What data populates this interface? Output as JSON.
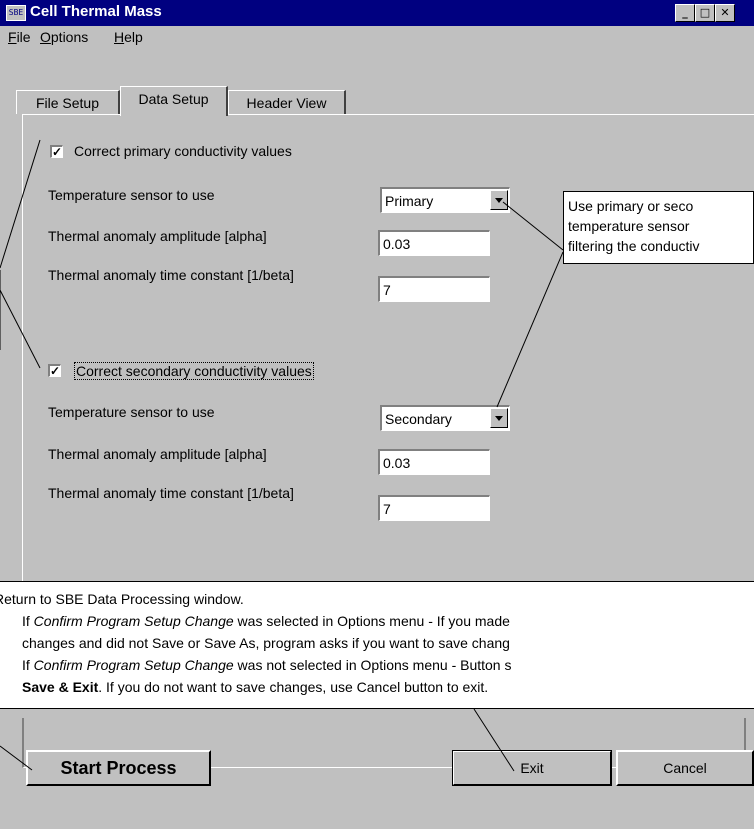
{
  "window": {
    "title": "Cell Thermal Mass",
    "icon": "sbe-app-icon"
  },
  "menu": [
    {
      "label": "File",
      "key": "F",
      "rest": "ile"
    },
    {
      "label": "Options",
      "key": "O",
      "rest": "ptions"
    },
    {
      "label": "Help",
      "key": "H",
      "rest": "elp"
    }
  ],
  "tabs": [
    "File Setup",
    "Data Setup",
    "Header View"
  ],
  "primary": {
    "checkbox_label": "Correct primary conductivity values",
    "checked": true,
    "sensor_label": "Temperature sensor to use",
    "sensor_value": "Primary",
    "alpha_label": "Thermal anomaly amplitude [alpha]",
    "alpha_value": "0.03",
    "beta_label": "Thermal anomaly time constant [1/beta]",
    "beta_value": "7"
  },
  "secondary": {
    "checkbox_label": "Correct secondary conductivity values",
    "checked": true,
    "sensor_label": "Temperature sensor to use",
    "sensor_value": "Secondary",
    "alpha_label": "Thermal anomaly amplitude [alpha]",
    "alpha_value": "0.03",
    "beta_label": "Thermal anomaly time constant [1/beta]",
    "beta_value": "7"
  },
  "callout_sensor": {
    "line1": "Use primary or seco",
    "line2": "temperature sensor",
    "line3": "filtering the conductiv"
  },
  "callout_exit": {
    "line1": "Return to SBE Data Processing window.",
    "line2_pre": "If ",
    "line2_em": "Confirm Program Setup Change",
    "line2_post": " was selected in Options menu - If you made",
    "line3": "changes and did not Save or Save As, program asks if you want to save chang",
    "line4_pre": "If ",
    "line4_em": "Confirm Program Setup Change",
    "line4_post": " was not selected in Options menu - Button s",
    "line5_bold": "Save & Exit",
    "line5_post": ". If you do not want to save changes, use Cancel button to exit."
  },
  "buttons": {
    "start": "Start Process",
    "exit": "Exit",
    "cancel": "Cancel"
  },
  "check_glyph": "✓"
}
